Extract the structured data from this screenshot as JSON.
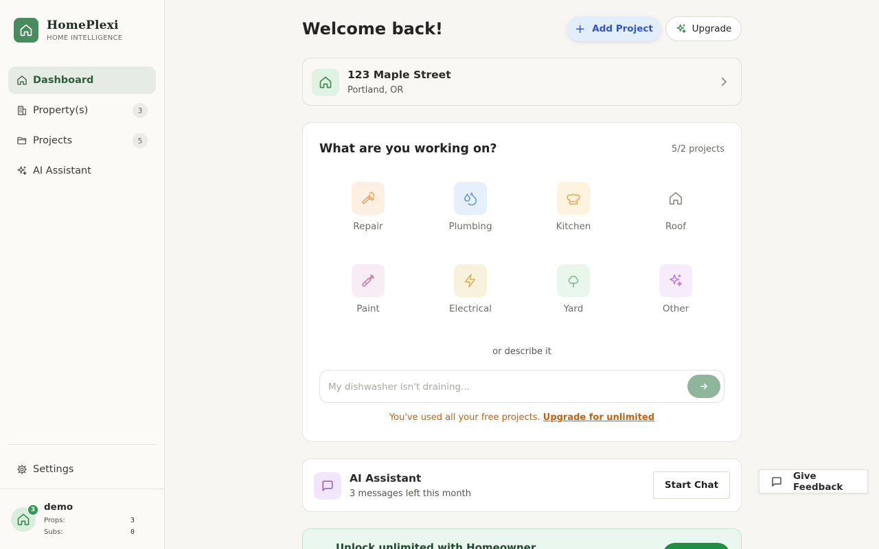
{
  "brand": {
    "name": "HomePlexi",
    "tagline": "HOME INTELLIGENCE"
  },
  "sidebar": {
    "items": [
      {
        "label": "Dashboard",
        "icon": "home-icon",
        "active": true
      },
      {
        "label": "Property(s)",
        "icon": "building-icon",
        "badge": "3"
      },
      {
        "label": "Projects",
        "icon": "folder-icon",
        "badge": "5"
      },
      {
        "label": "AI Assistant",
        "icon": "sparkles-icon"
      }
    ],
    "settings_label": "Settings"
  },
  "user": {
    "name": "demo",
    "notification_count": "3",
    "props_label": "Props:",
    "props_value": "3",
    "subs_label": "Subs:",
    "subs_value": "0"
  },
  "header": {
    "title": "Welcome back!",
    "add_project_label": "Add Project",
    "upgrade_label": "Upgrade"
  },
  "property": {
    "address": "123 Maple Street",
    "city": "Portland, OR"
  },
  "work": {
    "title": "What are you working on?",
    "count": "5/2 projects",
    "categories": [
      {
        "label": "Repair",
        "icon": "wrench-icon",
        "bg": "#fdf0e3",
        "color": "#e5a86f"
      },
      {
        "label": "Plumbing",
        "icon": "droplets-icon",
        "bg": "#e6f0fc",
        "color": "#6f9ad9"
      },
      {
        "label": "Kitchen",
        "icon": "chef-hat-icon",
        "bg": "#fdf3de",
        "color": "#e2b15c"
      },
      {
        "label": "Roof",
        "icon": "home-icon",
        "bg": "#ffffff",
        "color": "#8a8a84"
      },
      {
        "label": "Paint",
        "icon": "paintbrush-icon",
        "bg": "#f9edf5",
        "color": "#d27aaa"
      },
      {
        "label": "Electrical",
        "icon": "zap-icon",
        "bg": "#f8f1dc",
        "color": "#d9b25a"
      },
      {
        "label": "Yard",
        "icon": "tree-icon",
        "bg": "#e9f6ec",
        "color": "#7cbc8e"
      },
      {
        "label": "Other",
        "icon": "sparkles-icon",
        "bg": "#f6ecfb",
        "color": "#c47fdb"
      }
    ],
    "or_text": "or describe it",
    "placeholder": "My dishwasher isn't draining...",
    "limit_text": "You've used all your free projects.",
    "limit_link": "Upgrade for unlimited"
  },
  "ai_card": {
    "title": "AI Assistant",
    "subtitle": "3 messages left this month",
    "button": "Start Chat"
  },
  "promo": {
    "title": "Unlock unlimited with Homeowner"
  },
  "feedback": {
    "label": "Give Feedback"
  },
  "colors": {
    "brand_green": "#4a8a5f",
    "accent_blue": "#2f56c7",
    "warning_orange": "#c0620f",
    "success_green": "#2f9a4d"
  }
}
